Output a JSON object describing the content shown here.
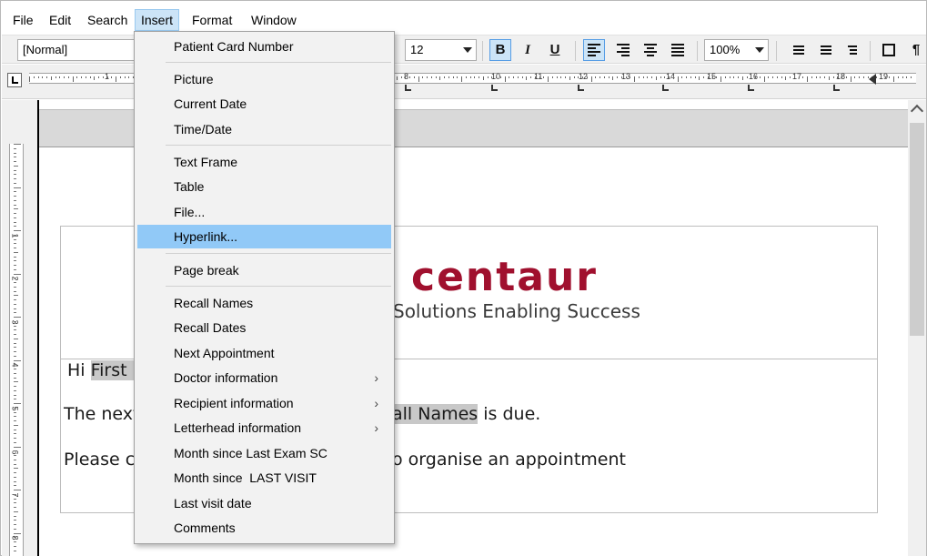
{
  "menubar": {
    "items": [
      "File",
      "Edit",
      "Search",
      "Insert",
      "Format",
      "Window"
    ]
  },
  "toolbar": {
    "style_value": "[Normal]",
    "font_size_value": "12",
    "zoom_value": "100%",
    "bold_label": "B",
    "italic_label": "I",
    "underline_label": "U",
    "pilcrow": "¶"
  },
  "ruler": {
    "numbers": [
      "1",
      "8",
      "10",
      "11",
      "12",
      "13",
      "14",
      "15",
      "16",
      "17",
      "18",
      "19"
    ],
    "vertical_numbers": [
      "1",
      "2",
      "3",
      "4",
      "5",
      "6",
      "7",
      "8"
    ]
  },
  "insert_menu": {
    "items": [
      {
        "label": "Patient Card Number"
      },
      {
        "label": "Picture"
      },
      {
        "label": "Current Date"
      },
      {
        "label": "Time/Date"
      },
      {
        "label": "Text Frame"
      },
      {
        "label": "Table"
      },
      {
        "label": "File..."
      },
      {
        "label": "Hyperlink...",
        "highlighted": true
      },
      {
        "label": "Page break"
      },
      {
        "label": "Recall Names"
      },
      {
        "label": "Recall Dates"
      },
      {
        "label": "Next Appointment"
      },
      {
        "label": "Doctor information",
        "submenu": true
      },
      {
        "label": "Recipient information",
        "submenu": true
      },
      {
        "label": "Letterhead information",
        "submenu": true
      },
      {
        "label": "Month since Last Exam SC"
      },
      {
        "label": "Month since  LAST VISIT"
      },
      {
        "label": "Last visit date"
      },
      {
        "label": "Comments"
      }
    ],
    "submenu_glyph": "›"
  },
  "document": {
    "logo_text": "centaur",
    "tagline": "Solutions Enabling Success",
    "greeting_prefix": "Hi ",
    "greeting_field": "First n",
    "line2_start": "The next",
    "line2_field": "all Names",
    "line2_end": " is due.",
    "line3_start": "Please c",
    "line3_end": "o organise an appointment"
  },
  "colors": {
    "logo": "#a0102e",
    "menu_highlight": "#91c9f7",
    "active_menu": "#cce4f7"
  }
}
